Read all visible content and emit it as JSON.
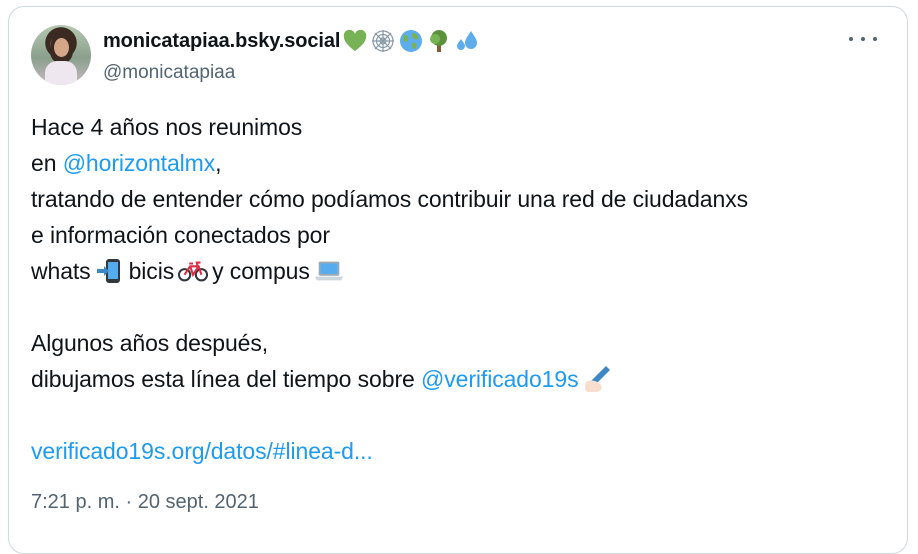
{
  "post": {
    "author": {
      "display_name": "monicatapiaa.bsky.social",
      "handle": "@monicatapiaa",
      "name_emojis": [
        "green-heart",
        "spider-web",
        "globe",
        "tree",
        "sweat-droplets"
      ]
    },
    "lines": {
      "l1": "Hace 4 años nos reunimos",
      "l2_pre": "en ",
      "l2_mention": "@horizontalmx",
      "l2_post": ",",
      "l3": "tratando de entender cómo podíamos contribuir una red de ciudadanxs",
      "l4": "e información conectados por",
      "l5_a": "whats",
      "l5_b": "bicis",
      "l5_c": "y compus",
      "l6": "Algunos años después,",
      "l7_pre": "dibujamos esta línea del tiempo sobre ",
      "l7_mention": "@verificado19s",
      "url": "verificado19s.org/datos/#linea-d..."
    },
    "inline_emojis": [
      "mobile-phone-arrow",
      "bicycle",
      "laptop",
      "writing-hand"
    ],
    "timestamp": "7:21 p. m. · 20 sept. 2021"
  },
  "colors": {
    "link": "#1d9bf0",
    "secondary_text": "#536471",
    "border": "#cfd9de"
  }
}
